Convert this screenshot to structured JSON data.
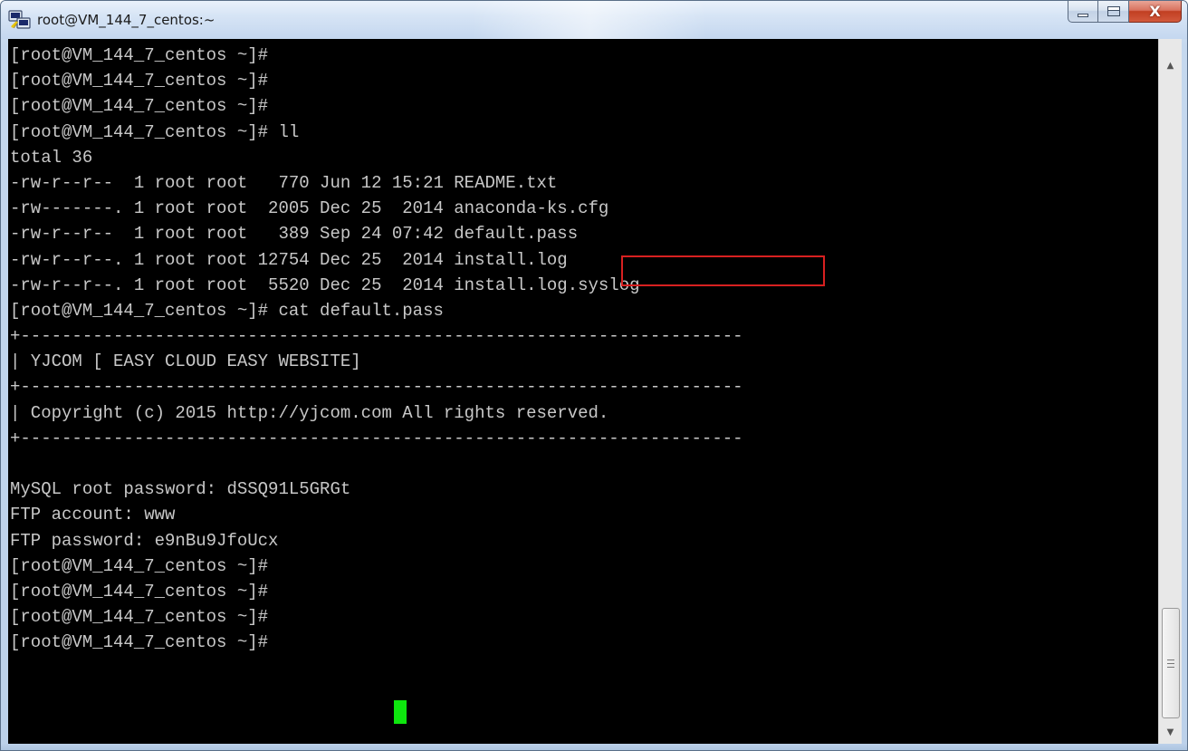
{
  "window": {
    "title": "root@VM_144_7_centos:~",
    "icon": "putty-icon",
    "controls": {
      "minimize": "minimize-icon",
      "maximize": "maximize-icon",
      "close_label": "X"
    }
  },
  "terminal": {
    "lines": [
      "[root@VM_144_7_centos ~]#",
      "[root@VM_144_7_centos ~]#",
      "[root@VM_144_7_centos ~]#",
      "[root@VM_144_7_centos ~]# ll",
      "total 36",
      "-rw-r--r--  1 root root   770 Jun 12 15:21 README.txt",
      "-rw-------. 1 root root  2005 Dec 25  2014 anaconda-ks.cfg",
      "-rw-r--r--  1 root root   389 Sep 24 07:42 default.pass",
      "-rw-r--r--. 1 root root 12754 Dec 25  2014 install.log",
      "-rw-r--r--. 1 root root  5520 Dec 25  2014 install.log.syslog",
      "[root@VM_144_7_centos ~]# cat default.pass",
      "+----------------------------------------------------------------------",
      "| YJCOM [ EASY CLOUD EASY WEBSITE]",
      "+----------------------------------------------------------------------",
      "| Copyright (c) 2015 http://yjcom.com All rights reserved.",
      "+----------------------------------------------------------------------",
      "",
      "MySQL root password: dSSQ91L5GRGt",
      "FTP account: www",
      "FTP password: e9nBu9JfoUcx",
      "[root@VM_144_7_centos ~]#",
      "[root@VM_144_7_centos ~]#",
      "[root@VM_144_7_centos ~]#",
      "[root@VM_144_7_centos ~]#"
    ],
    "highlighted_text": "default.pass",
    "highlight_color": "#d82020",
    "cursor_color": "#0ee60e"
  },
  "scrollbar": {
    "up_arrow": "▲",
    "down_arrow": "▼"
  }
}
